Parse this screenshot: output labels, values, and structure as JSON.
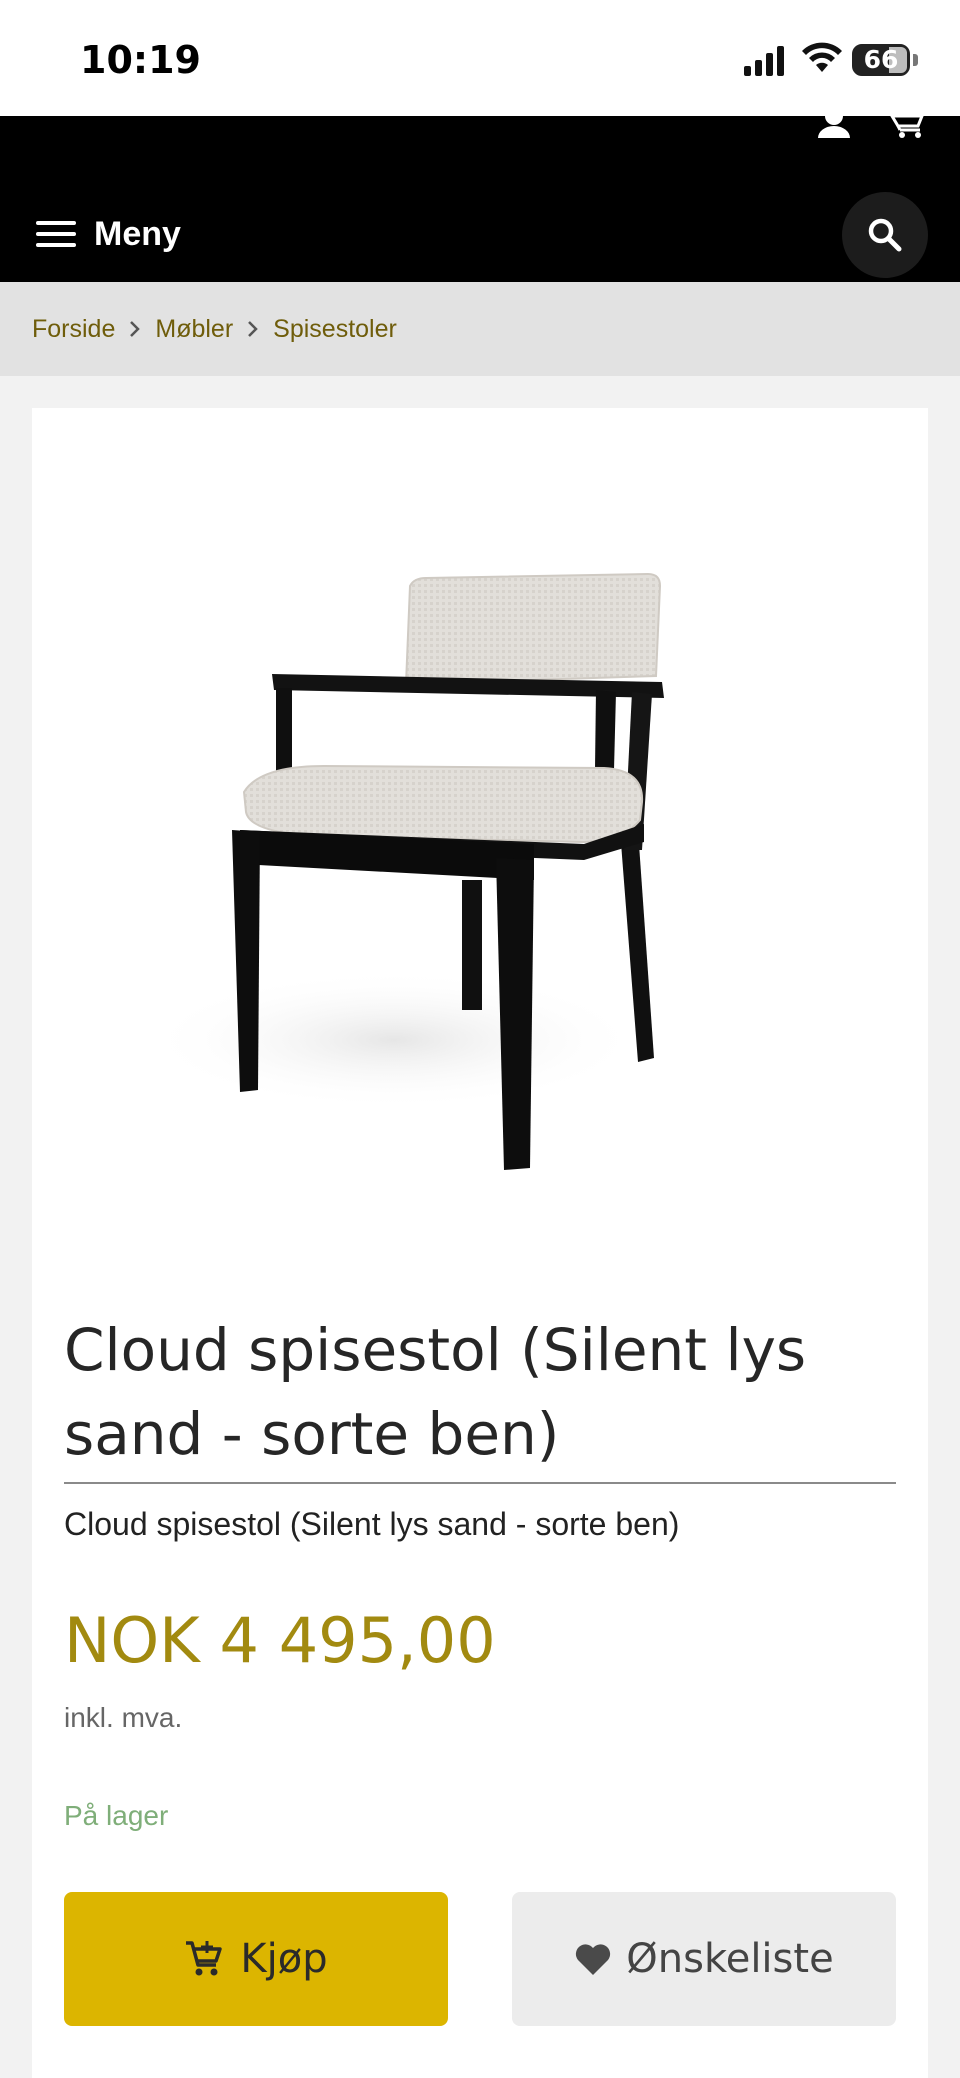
{
  "status_bar": {
    "time": "10:19",
    "battery_percent": "66",
    "icons": [
      "signal-icon",
      "wifi-icon",
      "battery-icon"
    ]
  },
  "header": {
    "menu_label": "Meny",
    "icons": [
      "hamburger-icon",
      "search-icon",
      "user-icon",
      "cart-icon"
    ],
    "brand_color": "#c9b32a",
    "background_color": "#000000"
  },
  "breadcrumb": {
    "items": [
      "Forside",
      "Møbler",
      "Spisestoler"
    ]
  },
  "product": {
    "image_alt": "chair-photo",
    "title": "Cloud spisestol (Silent lys sand - sorte ben)",
    "subtitle": "Cloud spisestol (Silent lys sand - sorte ben)",
    "price": "NOK 4 495,00",
    "vat_note": "inkl. mva.",
    "stock": "På lager",
    "price_color": "#a28a10",
    "stock_color": "#7fae79"
  },
  "actions": {
    "buy_label": "Kjøp",
    "wishlist_label": "Ønskeliste",
    "buy_color": "#dcb500",
    "icons": [
      "add-to-cart-icon",
      "heart-icon"
    ]
  }
}
